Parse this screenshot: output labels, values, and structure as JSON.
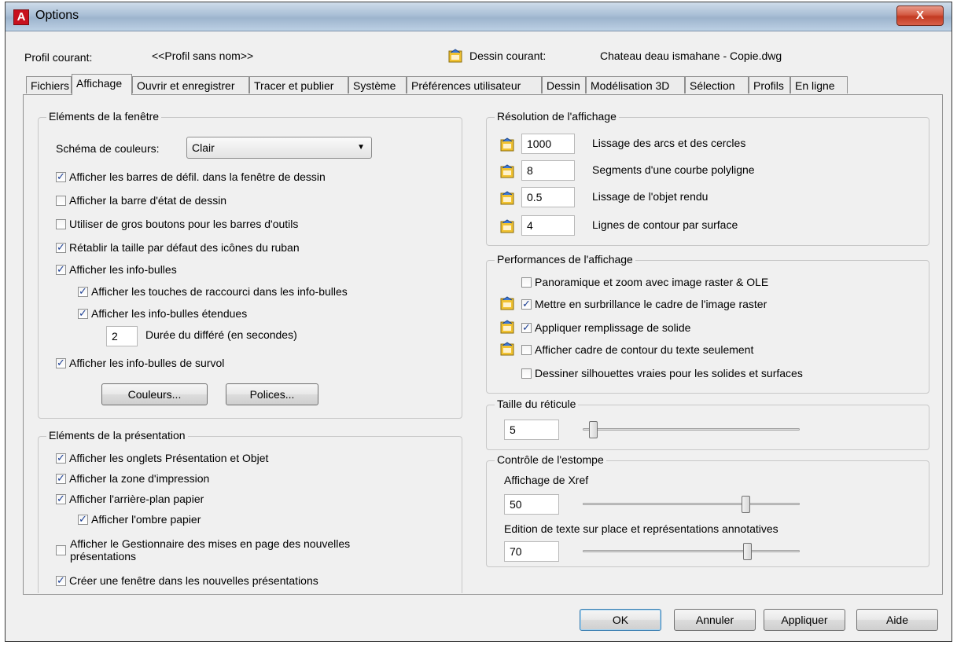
{
  "window": {
    "title": "Options",
    "app_icon_label": "A",
    "close_label": "X"
  },
  "profile": {
    "current_label": "Profil courant:",
    "current_value": "<<Profil sans nom>>",
    "drawing_label": "Dessin courant:",
    "drawing_value": "Chateau deau ismahane - Copie.dwg"
  },
  "tabs": [
    "Fichiers",
    "Affichage",
    "Ouvrir et enregistrer",
    "Tracer et publier",
    "Système",
    "Préférences utilisateur",
    "Dessin",
    "Modélisation 3D",
    "Sélection",
    "Profils",
    "En ligne"
  ],
  "active_tab": "Affichage",
  "window_elements": {
    "title": "Eléments de la fenêtre",
    "color_scheme_label": "Schéma de couleurs:",
    "color_scheme_value": "Clair",
    "options": [
      {
        "label": "Afficher les barres de défil. dans la fenêtre de dessin",
        "checked": true
      },
      {
        "label": "Afficher la barre d'état de dessin",
        "checked": false
      },
      {
        "label": "Utiliser de gros boutons pour les barres d'outils",
        "checked": false
      },
      {
        "label": "Rétablir la taille par défaut des icônes du ruban",
        "checked": true
      },
      {
        "label": "Afficher les info-bulles",
        "checked": true
      },
      {
        "label": "Afficher les touches de raccourci dans les info-bulles",
        "checked": true
      },
      {
        "label": "Afficher les info-bulles étendues",
        "checked": true
      },
      {
        "label": "Afficher les info-bulles de survol",
        "checked": true
      }
    ],
    "delay_value": "2",
    "delay_label": "Durée du différé (en secondes)",
    "colors_button": "Couleurs...",
    "fonts_button": "Polices..."
  },
  "layout_elements": {
    "title": "Eléments de la présentation",
    "options": [
      {
        "label": "Afficher les onglets Présentation et Objet",
        "checked": true
      },
      {
        "label": "Afficher la zone d'impression",
        "checked": true
      },
      {
        "label": "Afficher l'arrière-plan papier",
        "checked": true
      },
      {
        "label": "Afficher l'ombre papier",
        "checked": true
      },
      {
        "label_line1": "Afficher le Gestionnaire des mises en page des nouvelles",
        "label_line2": "présentations",
        "checked": false
      },
      {
        "label": "Créer une fenêtre dans les nouvelles présentations",
        "checked": true
      }
    ]
  },
  "display_resolution": {
    "title": "Résolution de l'affichage",
    "rows": [
      {
        "value": "1000",
        "label": "Lissage des arcs et des cercles"
      },
      {
        "value": "8",
        "label": "Segments d'une courbe polyligne"
      },
      {
        "value": "0.5",
        "label": "Lissage de l'objet rendu"
      },
      {
        "value": "4",
        "label": "Lignes de contour par surface"
      }
    ]
  },
  "display_performance": {
    "title": "Performances de l'affichage",
    "options": [
      {
        "label": "Panoramique et zoom avec image raster & OLE",
        "checked": false,
        "icon": false
      },
      {
        "label": "Mettre en surbrillance le cadre de l'image raster",
        "checked": true,
        "icon": true
      },
      {
        "label": "Appliquer remplissage de solide",
        "checked": true,
        "icon": true
      },
      {
        "label": "Afficher cadre de contour du texte seulement",
        "checked": false,
        "icon": true
      },
      {
        "label": "Dessiner silhouettes vraies pour les solides et surfaces",
        "checked": false,
        "icon": false
      }
    ]
  },
  "crosshair": {
    "title": "Taille du réticule",
    "value": "5",
    "level": 5
  },
  "fade_control": {
    "title": "Contrôle de l'estompe",
    "xref_label": "Affichage de Xref",
    "xref_value": "50",
    "xref_level": 50,
    "inplace_label": "Edition de texte sur place et représentations annotatives",
    "inplace_value": "70",
    "inplace_level": 70
  },
  "buttons": {
    "ok": "OK",
    "cancel": "Annuler",
    "apply": "Appliquer",
    "help": "Aide"
  }
}
